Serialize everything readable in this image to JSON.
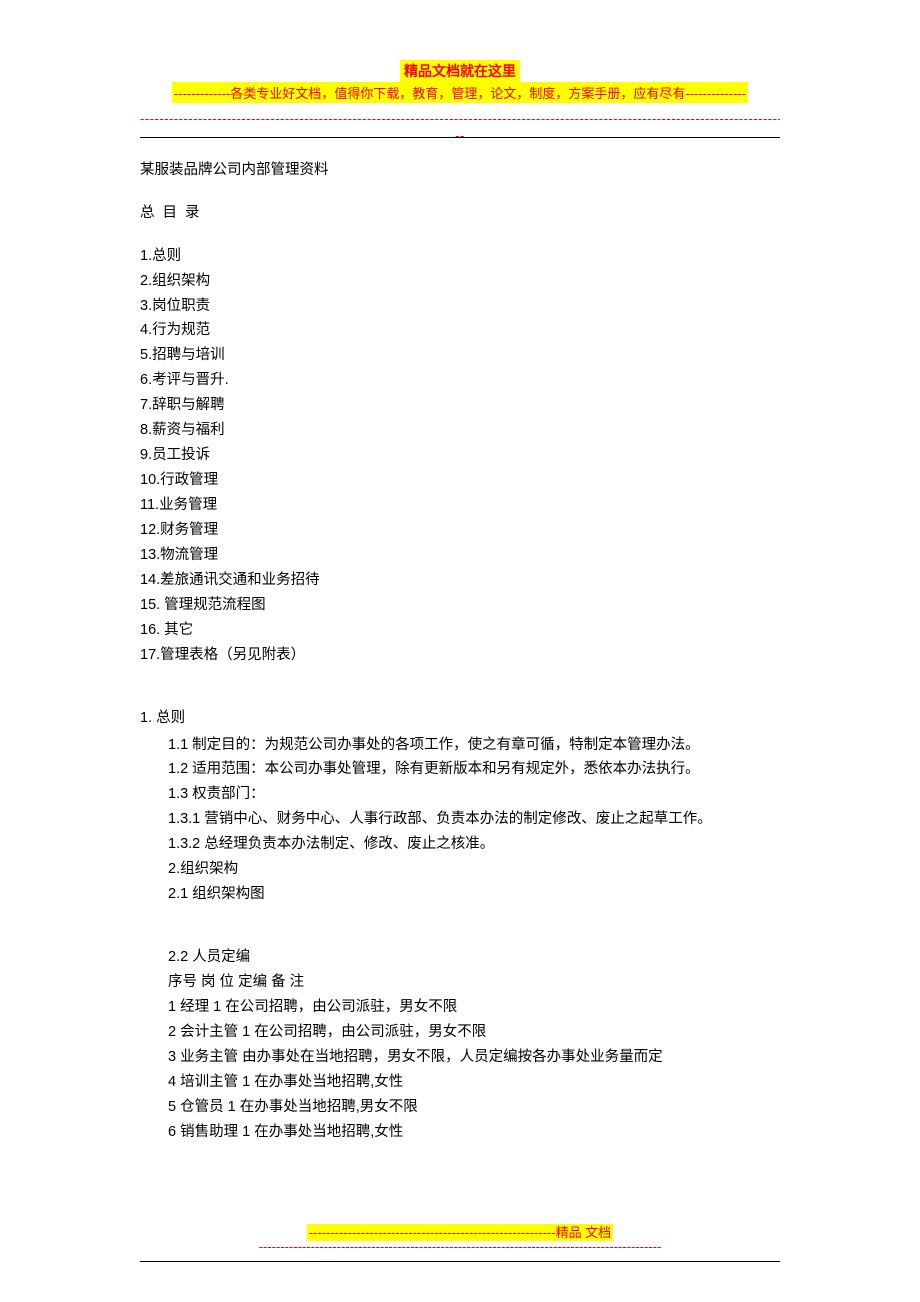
{
  "header": {
    "line1": "精品文档就在这里",
    "line2_prefix": "-------------",
    "line2_text": "各类专业好文档，值得你下载，教育，管理，论文，制度，方案手册，应有尽有",
    "line2_suffix": "--------------",
    "dashes_row1": "----------------------------------------------------------------------------------------------------------------------------------------------",
    "dashes_row2": "--"
  },
  "document": {
    "title": "某服装品牌公司内部管理资料",
    "toc_heading": "总 目 录",
    "toc": [
      "1.总则",
      "2.组织架构",
      "3.岗位职责",
      "4.行为规范",
      "5.招聘与培训",
      "6.考评与晋升.",
      "7.辞职与解聘",
      "8.薪资与福利",
      "9.员工投诉",
      "10.行政管理",
      "11.业务管理",
      "12.财务管理",
      "13.物流管理",
      "14.差旅通讯交通和业务招待",
      "15.  管理规范流程图",
      "16.  其它",
      "17.管理表格（另见附表）"
    ],
    "section1_label": "1.   总则",
    "section1_lines": [
      "1.1 制定目的：为规范公司办事处的各项工作，使之有章可循，特制定本管理办法。",
      "1.2 适用范围：本公司办事处管理，除有更新版本和另有规定外，悉依本办法执行。",
      "1.3 权责部门：",
      "1.3.1 营销中心、财务中心、人事行政部、负责本办法的制定修改、废止之起草工作。",
      "1.3.2 总经理负责本办法制定、修改、废止之核准。",
      "2.组织架构",
      "2.1 组织架构图"
    ],
    "section2_lines": [
      "2.2 人员定编",
      "序号  岗 位  定编  备 注",
      "1  经理  1  在公司招聘，由公司派驻，男女不限",
      "2  会计主管  1  在公司招聘，由公司派驻，男女不限",
      "3  业务主管   由办事处在当地招聘，男女不限，人员定编按各办事处业务量而定",
      "4  培训主管  1  在办事处当地招聘,女性",
      "5  仓管员  1  在办事处当地招聘,男女不限",
      "6  销售助理  1  在办事处当地招聘,女性"
    ]
  },
  "footer": {
    "dashes": "---------------------------------------------------------",
    "label": "精品   文档",
    "dashes2": "---------------------------------------------------------------------------------------------"
  }
}
